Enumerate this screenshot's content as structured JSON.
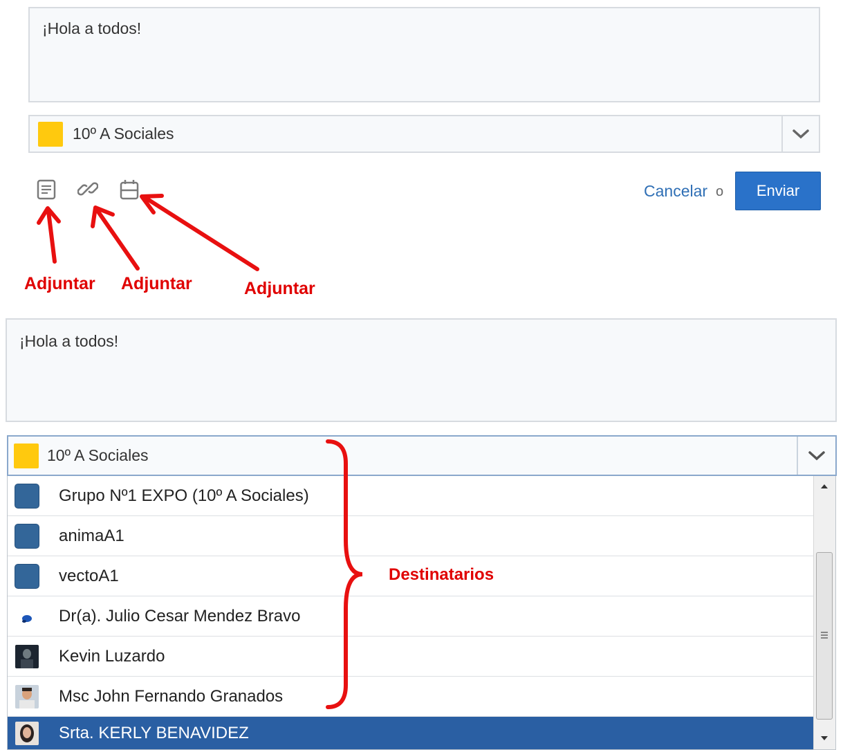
{
  "top": {
    "message": "¡Hola a todos!",
    "group": "10º A Sociales",
    "cancel_label": "Cancelar",
    "or_label": "o",
    "send_label": "Enviar",
    "annotations": [
      "Adjuntar",
      "Adjuntar",
      "Adjuntar"
    ]
  },
  "bottom": {
    "message": "¡Hola a todos!",
    "group": "10º A Sociales",
    "recipients_annotation": "Destinatarios",
    "recipients": [
      {
        "label": "Grupo Nº1 EXPO (10º A Sociales)",
        "kind": "group"
      },
      {
        "label": "animaA1",
        "kind": "group"
      },
      {
        "label": "vectoA1",
        "kind": "group"
      },
      {
        "label": "Dr(a). Julio Cesar Mendez Bravo",
        "kind": "user"
      },
      {
        "label": "Kevin Luzardo",
        "kind": "user"
      },
      {
        "label": "Msc John Fernando Granados",
        "kind": "user"
      },
      {
        "label": "Srta. KERLY BENAVIDEZ",
        "kind": "user",
        "selected": true
      }
    ]
  },
  "colors": {
    "accent": "#2a72c9",
    "group_swatch": "#ffc90e",
    "annotation": "#e00000",
    "selected_row": "#2a5fa3"
  },
  "icons": [
    "note-icon",
    "link-icon",
    "calendar-icon",
    "chevron-down-icon"
  ]
}
